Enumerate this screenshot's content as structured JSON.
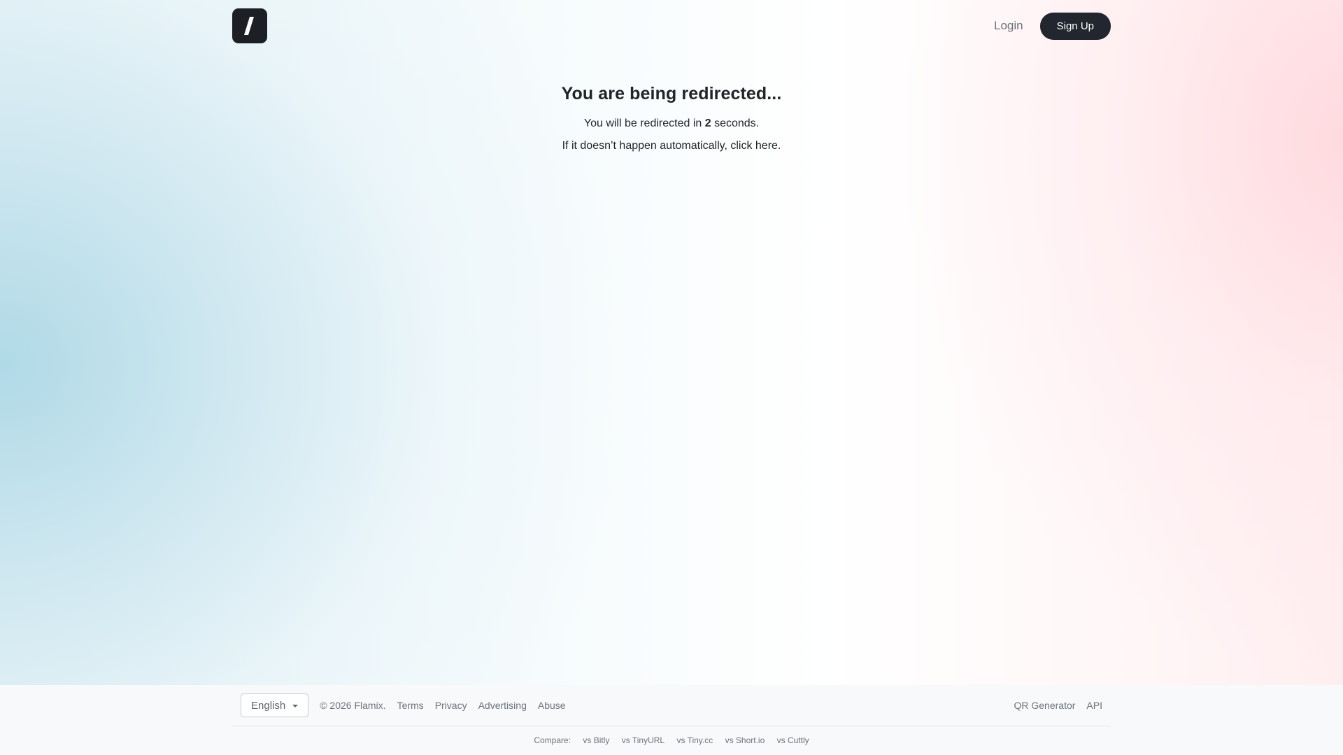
{
  "header": {
    "logo_icon": "slash-icon",
    "login_label": "Login",
    "signup_label": "Sign Up"
  },
  "main": {
    "title": "You are being redirected...",
    "countdown_prefix": "You will be redirected in ",
    "countdown_value": "2",
    "countdown_suffix": " seconds.",
    "fallback_prefix": "If it doesn’t happen automatically, ",
    "fallback_link": "click here",
    "fallback_suffix": "."
  },
  "footer": {
    "language": "English",
    "copyright": "© 2026 Flamix.",
    "links_left": [
      "Terms",
      "Privacy",
      "Advertising",
      "Abuse"
    ],
    "links_right": [
      "QR Generator",
      "API"
    ],
    "compare_label": "Compare:",
    "compare_links": [
      "vs Bitly",
      "vs TinyURL",
      "vs Tiny.cc",
      "vs Short.io",
      "vs Cuttly"
    ]
  },
  "colors": {
    "logo_bg": "#1c1f24",
    "signup_bg": "#22262e",
    "footer_bg": "#f8f9fa",
    "text_muted": "#6c737a"
  }
}
